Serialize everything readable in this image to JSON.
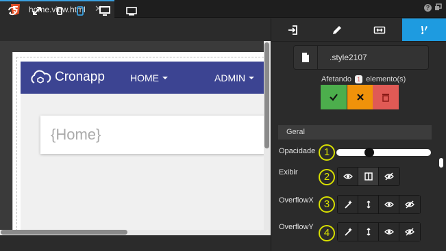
{
  "editor": {
    "tab_title": "home.view.html",
    "tab_close": "✕",
    "help_label": "?"
  },
  "device_toolbar": {
    "icons": [
      "refresh-icon",
      "fullscreen-icon",
      "phone-icon",
      "tablet-icon",
      "desktop-icon",
      "monitor-icon"
    ],
    "active": "tablet-icon",
    "accent": "#3aa0e0"
  },
  "preview": {
    "brand": "Cronapp",
    "nav_items": [
      "HOME",
      "ADMIN"
    ],
    "card_title": "{Home}",
    "navbar_color": "#3c4492"
  },
  "panel": {
    "tabs": [
      "import-icon",
      "pencil-icon",
      "resize-horizontal-icon",
      "style-brush-icon"
    ],
    "active_tab": "style-brush-icon",
    "active_color": "#1e9be0",
    "style_name": ".style2107",
    "affecting_prefix": "Afetando",
    "affecting_count": "1",
    "affecting_suffix": "elemento(s)",
    "section_title": "Geral",
    "properties": [
      {
        "label": "Opacidade",
        "number": "1"
      },
      {
        "label": "Exibir",
        "number": "2"
      },
      {
        "label": "OverflowX",
        "number": "3"
      },
      {
        "label": "OverflowY",
        "number": "4"
      }
    ],
    "opacity_value": 0.33,
    "colors": {
      "confirm": "#4cae4c",
      "cancel": "#f0920a",
      "delete": "#e05a55",
      "annotation": "#d8e000"
    }
  }
}
